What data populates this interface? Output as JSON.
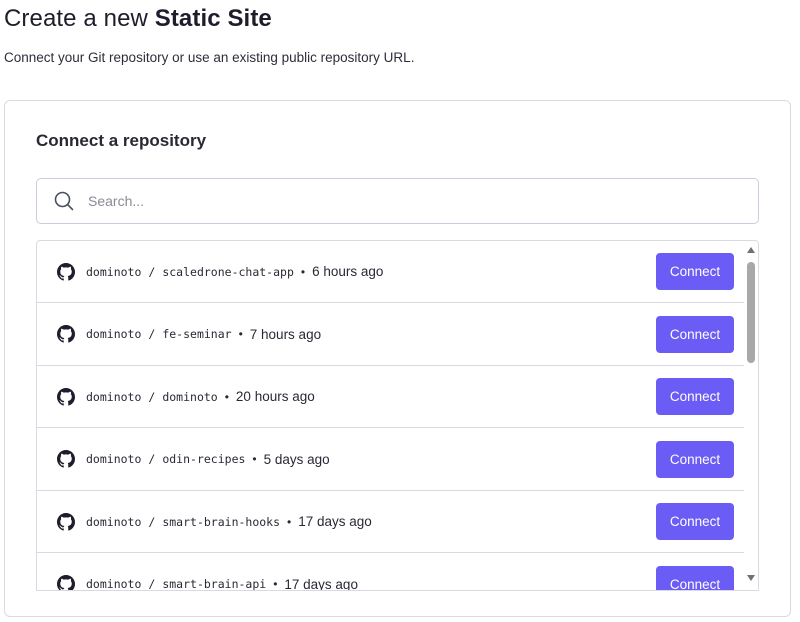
{
  "header": {
    "title_prefix": "Create a new ",
    "title_emphasis": "Static Site",
    "subtitle": "Connect your Git repository or use an existing public repository URL."
  },
  "card": {
    "title": "Connect a repository",
    "search": {
      "placeholder": "Search...",
      "value": "",
      "icon": "search-icon"
    }
  },
  "repositories": [
    {
      "owner": "dominoto",
      "name": "scaledrone-chat-app",
      "time": "6 hours ago",
      "button": "Connect"
    },
    {
      "owner": "dominoto",
      "name": "fe-seminar",
      "time": "7 hours ago",
      "button": "Connect"
    },
    {
      "owner": "dominoto",
      "name": "dominoto",
      "time": "20 hours ago",
      "button": "Connect"
    },
    {
      "owner": "dominoto",
      "name": "odin-recipes",
      "time": "5 days ago",
      "button": "Connect"
    },
    {
      "owner": "dominoto",
      "name": "smart-brain-hooks",
      "time": "17 days ago",
      "button": "Connect"
    },
    {
      "owner": "dominoto",
      "name": "smart-brain-api",
      "time": "17 days ago",
      "button": "Connect"
    }
  ],
  "colors": {
    "accent": "#6b5cf6",
    "border": "#d9d9e3",
    "text": "#1f1d2b"
  },
  "icons": {
    "repo": "github-icon",
    "search": "search-icon"
  }
}
